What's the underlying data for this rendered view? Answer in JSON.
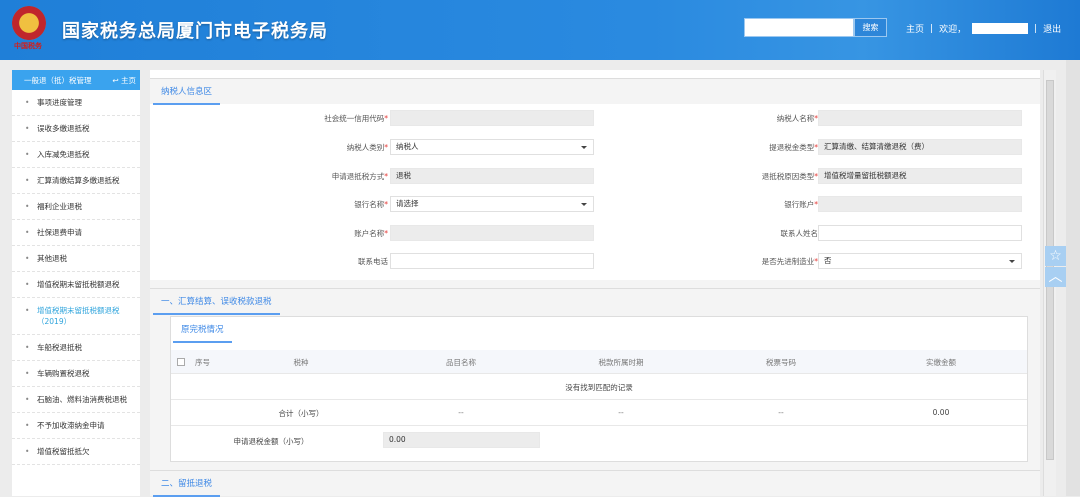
{
  "header": {
    "title": "国家税务总局厦门市电子税务局",
    "emblem_text": "中国税务",
    "search_button": "搜索",
    "search_value": "",
    "home": "主页",
    "welcome": "欢迎，",
    "logout": "退出"
  },
  "sidebar": {
    "title": "一般退（抵）税管理",
    "home": "主页",
    "items": [
      "事项进度管理",
      "误收多缴退抵税",
      "入库减免退抵税",
      "汇算清缴结算多缴退抵税",
      "福利企业退税",
      "社保退费申请",
      "其他退税",
      "增值税期末留抵税额退税",
      "增值税期末留抵税额退税（2019）",
      "车船税退抵税",
      "车辆购置税退税",
      "石脑油、燃料油消费税退税",
      "不予加收滞纳金申请",
      "增值税留抵抵欠"
    ]
  },
  "taxpayer": {
    "tab": "纳税人信息区",
    "left": [
      {
        "label": "社会统一信用代码",
        "value": ""
      },
      {
        "label": "纳税人类别",
        "value": "纳税人"
      },
      {
        "label": "申请退抵税方式",
        "value": "退税"
      },
      {
        "label": "银行名称",
        "value": "请选择"
      },
      {
        "label": "账户名称",
        "value": ""
      },
      {
        "label": "联系电话",
        "value": ""
      }
    ],
    "right": [
      {
        "label": "纳税人名称",
        "value": ""
      },
      {
        "label": "提退税金类型",
        "value": "汇算清缴、结算清缴退税（费）"
      },
      {
        "label": "退抵税原因类型",
        "value": "增值税增量留抵税额退税"
      },
      {
        "label": "银行账户",
        "value": ""
      },
      {
        "label": "联系人姓名",
        "value": ""
      },
      {
        "label": "是否先进制造业",
        "value": "否"
      }
    ]
  },
  "section1": {
    "title": "一、汇算结算、误收税款退税",
    "subtab": "原完税情况",
    "columns": [
      "序号",
      "税种",
      "品目名称",
      "税款所属时期",
      "税票号码",
      "实缴金额"
    ],
    "empty": "没有找到匹配的记录",
    "total_label": "合计（小写）",
    "total_values": [
      "--",
      "--",
      "--",
      "0.00"
    ],
    "apply_label": "申请退税金额（小写）",
    "apply_value": "0.00"
  },
  "section2": {
    "title": "二、留抵退税"
  }
}
